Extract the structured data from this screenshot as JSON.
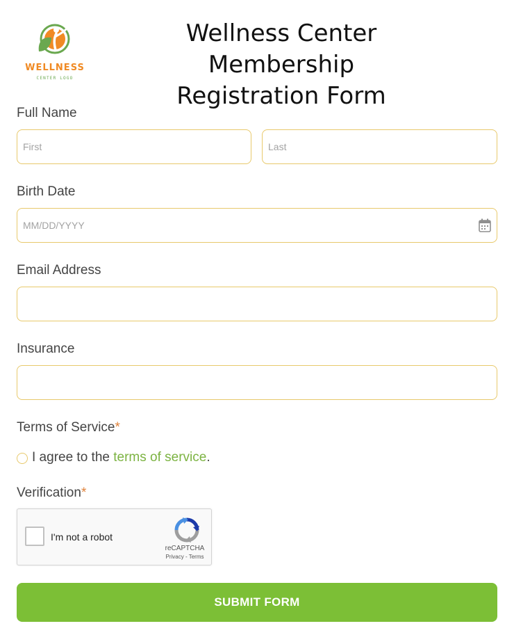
{
  "logo": {
    "word": "WELLNESS",
    "sub": "CENTER LOGO",
    "colors": {
      "orange": "#f08a24",
      "green": "#6aa84f"
    }
  },
  "header": {
    "title_line1": "Wellness Center Membership",
    "title_line2": "Registration Form"
  },
  "form": {
    "full_name": {
      "label": "Full Name",
      "first": {
        "value": "",
        "placeholder": "First"
      },
      "last": {
        "value": "",
        "placeholder": "Last"
      }
    },
    "birth_date": {
      "label": "Birth Date",
      "value": "",
      "placeholder": "MM/DD/YYYY",
      "icon": "calendar-icon"
    },
    "email": {
      "label": "Email Address",
      "value": "",
      "placeholder": ""
    },
    "insurance": {
      "label": "Insurance",
      "value": "",
      "placeholder": ""
    },
    "terms": {
      "label": "Terms of Service",
      "required_mark": "*",
      "agree_prefix": "I agree to the ",
      "agree_link": "terms of service",
      "agree_suffix": ".",
      "checked": false
    },
    "verification": {
      "label": "Verification",
      "required_mark": "*",
      "captcha_text": "I'm not a robot",
      "captcha_brand": "reCAPTCHA",
      "privacy": "Privacy",
      "separator": " - ",
      "terms": "Terms"
    },
    "submit_label": "SUBMIT FORM"
  },
  "colors": {
    "accent_green": "#7cbf36",
    "link_green": "#7cb342",
    "field_border": "#e8c96b",
    "required": "#e0823b"
  }
}
